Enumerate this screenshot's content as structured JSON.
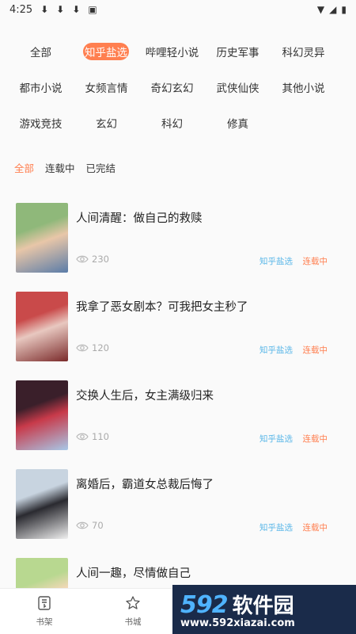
{
  "status_bar": {
    "time": "4:25",
    "notif_glyphs": [
      "⬇",
      "⬇",
      "⬇",
      "▣"
    ],
    "wifi_glyph": "▼",
    "signal_glyph": "◢",
    "battery_glyph": "▮"
  },
  "categories": [
    {
      "label": "全部",
      "active": false
    },
    {
      "label": "知乎盐选",
      "active": true
    },
    {
      "label": "哔哩轻小说",
      "active": false
    },
    {
      "label": "历史军事",
      "active": false
    },
    {
      "label": "科幻灵异",
      "active": false
    },
    {
      "label": "都市小说",
      "active": false
    },
    {
      "label": "女频言情",
      "active": false
    },
    {
      "label": "奇幻玄幻",
      "active": false
    },
    {
      "label": "武侠仙侠",
      "active": false
    },
    {
      "label": "其他小说",
      "active": false
    },
    {
      "label": "游戏竞技",
      "active": false
    },
    {
      "label": "玄幻",
      "active": false
    },
    {
      "label": "科幻",
      "active": false
    },
    {
      "label": "修真",
      "active": false
    }
  ],
  "status_tabs": [
    {
      "label": "全部",
      "active": true
    },
    {
      "label": "连载中",
      "active": false
    },
    {
      "label": "已完结",
      "active": false
    }
  ],
  "books": [
    {
      "title": "人间清醒：做自己的救赎",
      "views": "230",
      "source": "知乎盐选",
      "status": "连载中",
      "cover_colors": [
        "#8fb87a",
        "#e8c6a8",
        "#5a7ca8"
      ]
    },
    {
      "title": "我拿了恶女剧本？可我把女主秒了",
      "views": "120",
      "source": "知乎盐选",
      "status": "连载中",
      "cover_colors": [
        "#c94a4a",
        "#e8c8c0",
        "#7a2a2a"
      ]
    },
    {
      "title": "交换人生后，女主满级归来",
      "views": "110",
      "source": "知乎盐选",
      "status": "连载中",
      "cover_colors": [
        "#3a1f2a",
        "#c83a4a",
        "#a8c8e8"
      ]
    },
    {
      "title": "离婚后，霸道女总裁后悔了",
      "views": "70",
      "source": "知乎盐选",
      "status": "连载中",
      "cover_colors": [
        "#c8d4e0",
        "#2a2a30",
        "#f0f0f0"
      ]
    },
    {
      "title": "人间一趣，尽情做自己",
      "views": "",
      "source": "",
      "status": "",
      "cover_colors": [
        "#b8d890",
        "#f4d8b8",
        "#7aa860"
      ]
    }
  ],
  "view_icon": "eye-icon",
  "bottom_nav": [
    {
      "label": "书架",
      "icon": "bookshelf-icon"
    },
    {
      "label": "书城",
      "icon": "bookstore-icon"
    }
  ],
  "watermark": {
    "number": "592",
    "chinese": "软件园",
    "url": "www.592xiazai.com"
  },
  "colors": {
    "accent": "#ff7f50",
    "source_tag": "#5ab7e8",
    "muted": "#aaaaaa"
  }
}
